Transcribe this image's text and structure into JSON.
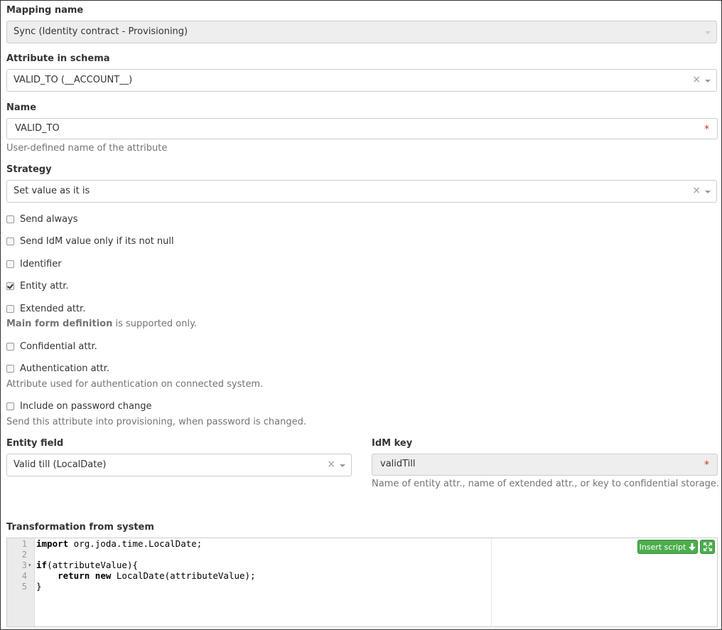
{
  "mapping_name": {
    "label": "Mapping name",
    "value": "Sync (Identity contract - Provisioning)"
  },
  "attribute_in_schema": {
    "label": "Attribute in schema",
    "value": "VALID_TO (__ACCOUNT__)"
  },
  "name": {
    "label": "Name",
    "value": "VALID_TO",
    "help": "User-defined name of the attribute",
    "required_mark": "*"
  },
  "strategy": {
    "label": "Strategy",
    "value": "Set value as it is"
  },
  "checkboxes": [
    {
      "label": "Send always",
      "checked": false
    },
    {
      "label": "Send IdM value only if its not null",
      "checked": false
    },
    {
      "label": "Identifier",
      "checked": false
    },
    {
      "label": "Entity attr.",
      "checked": true
    },
    {
      "label": "Extended attr.",
      "checked": false
    },
    {
      "label": "Confidential attr.",
      "checked": false
    },
    {
      "label": "Authentication attr.",
      "checked": false
    },
    {
      "label": "Include on password change",
      "checked": false
    }
  ],
  "extended_help": {
    "bold": "Main form definition",
    "rest": " is supported only."
  },
  "auth_help": "Attribute used for authentication on connected system.",
  "password_help": "Send this attribute into provisioning, when password is changed.",
  "entity_field": {
    "label": "Entity field",
    "value": "Valid till (LocalDate)"
  },
  "idm_key": {
    "label": "IdM key",
    "value": "validTill",
    "help": "Name of entity attr., name of extended attr., or key to confidential storage.",
    "required_mark": "*"
  },
  "transformation": {
    "label": "Transformation from system",
    "insert_script_label": "Insert script",
    "line_numbers": [
      "1",
      "2",
      "3",
      "4",
      "5"
    ]
  },
  "icons": {
    "clear": "×",
    "fold": "▾",
    "download": "arrow-down-icon",
    "fullscreen": "expand-icon"
  },
  "colors": {
    "required": "#c9302c",
    "button_green": "#4cae4c"
  }
}
